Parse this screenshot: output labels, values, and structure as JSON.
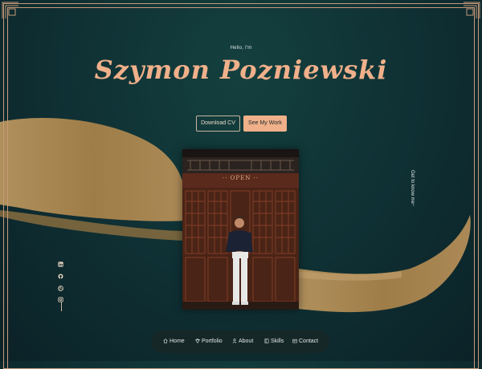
{
  "hero": {
    "greeting": "Hello, I'm",
    "name": "Szymon Pozniewski"
  },
  "buttons": {
    "download_cv": "Download CV",
    "see_work": "See My Work"
  },
  "photo": {
    "sign": "·· OPEN ··"
  },
  "side_link": {
    "label": "Get to know me",
    "arrow": "→"
  },
  "social": [
    "linkedin-icon",
    "github-icon",
    "dribbble-icon",
    "instagram-icon"
  ],
  "nav": {
    "items": [
      {
        "label": "Home",
        "icon": "home-icon"
      },
      {
        "label": "Portfolio",
        "icon": "portfolio-icon"
      },
      {
        "label": "About",
        "icon": "user-icon"
      },
      {
        "label": "Skills",
        "icon": "book-icon"
      },
      {
        "label": "Contact",
        "icon": "contact-icon"
      }
    ]
  },
  "colors": {
    "background": "#0f2f33",
    "accent": "#f0b08a",
    "brush": "#a88450",
    "frame": "#c79a78"
  }
}
